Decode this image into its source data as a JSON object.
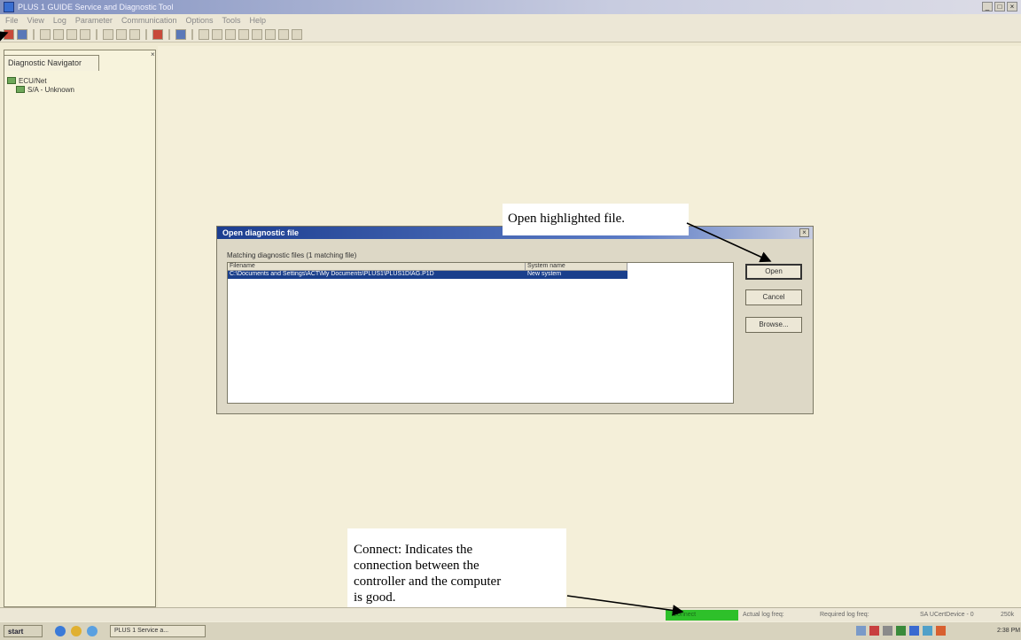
{
  "window": {
    "title": "PLUS 1 GUIDE Service and Diagnostic Tool",
    "controls": [
      "_",
      "□",
      "×"
    ]
  },
  "menu": [
    "File",
    "View",
    "Log",
    "Parameter",
    "Communication",
    "Options",
    "Tools",
    "Help"
  ],
  "navigator": {
    "tab_label": "Diagnostic Navigator",
    "close_glyph": "×",
    "tree": [
      {
        "label": "ECU/Net"
      },
      {
        "label": "S/A - Unknown"
      }
    ]
  },
  "dialog": {
    "title": "Open diagnostic file",
    "close_glyph": "×",
    "matching_label": "Matching diagnostic files (1 matching file)",
    "columns": [
      "Filename",
      "System name"
    ],
    "rows": [
      {
        "filename": "C:\\Documents and Settings\\ACT\\My Documents\\PLUS1\\PLUS1DIAG.P1D",
        "system": "New system"
      }
    ],
    "buttons": {
      "open": "Open",
      "cancel": "Cancel",
      "browse": "Browse..."
    }
  },
  "callouts": {
    "open": "Open highlighted file.",
    "connect_lines": [
      "Connect: Indicates the",
      "connection between the",
      "controller and   the computer",
      "is good."
    ]
  },
  "statusbar": {
    "connect": "Connect",
    "actual_log_freq": "Actual log freq:",
    "required_log_freq": "Required log freq:",
    "device": "SA UCertDevice - 0",
    "baud": "250k"
  },
  "taskbar": {
    "start": "start",
    "task_button": "PLUS 1 Service a...",
    "clock": "2:38 PM"
  }
}
